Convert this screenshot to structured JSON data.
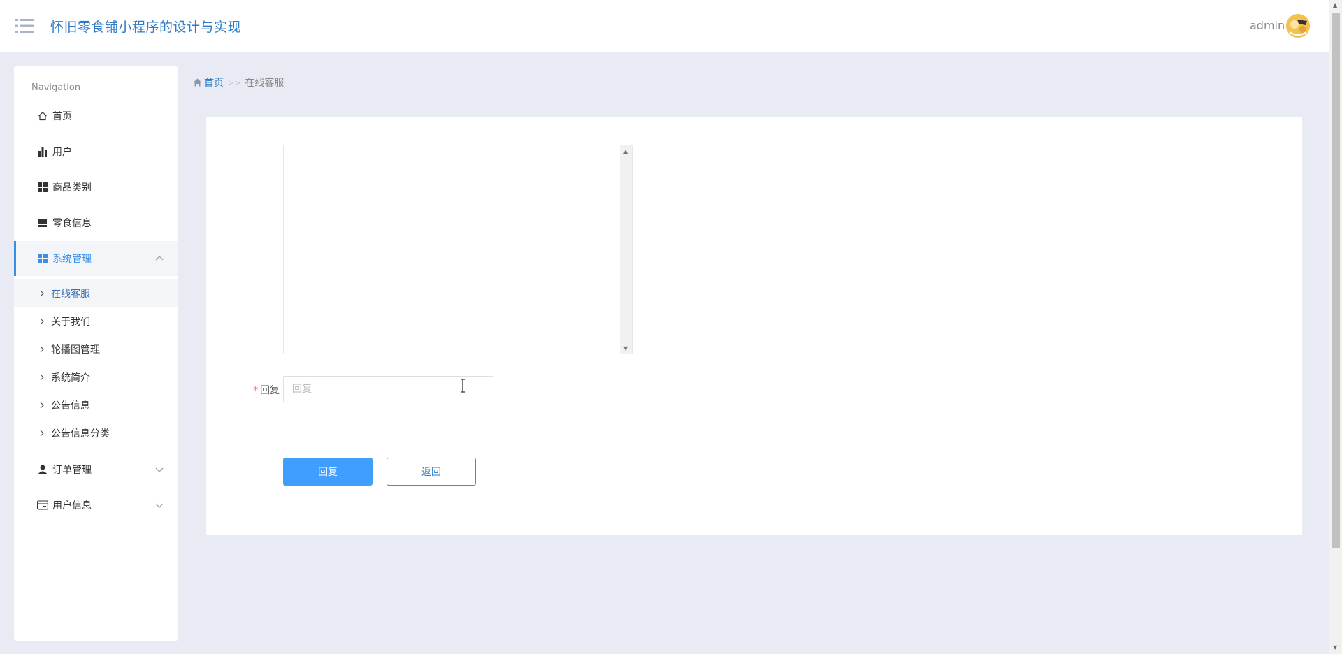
{
  "header": {
    "app_title": "怀旧零食铺小程序的设计与实现",
    "username": "admin"
  },
  "sidebar": {
    "caption": "Navigation",
    "items": [
      {
        "label": "首页",
        "icon": "home-icon"
      },
      {
        "label": "用户",
        "icon": "bar-chart-icon"
      },
      {
        "label": "商品类别",
        "icon": "grid-icon"
      },
      {
        "label": "零食信息",
        "icon": "shop-icon"
      },
      {
        "label": "系统管理",
        "icon": "grid-icon",
        "expanded": true
      },
      {
        "label": "订单管理",
        "icon": "user-icon"
      },
      {
        "label": "用户信息",
        "icon": "card-icon"
      }
    ],
    "sub_items": [
      {
        "label": "在线客服",
        "active": true
      },
      {
        "label": "关于我们"
      },
      {
        "label": "轮播图管理"
      },
      {
        "label": "系统简介"
      },
      {
        "label": "公告信息"
      },
      {
        "label": "公告信息分类"
      }
    ]
  },
  "breadcrumb": {
    "home": "首页",
    "separator": ">>",
    "current": "在线客服"
  },
  "form": {
    "reply_label": "回复",
    "required_mark": "*",
    "reply_placeholder": "回复",
    "reply_value": "",
    "submit_label": "回复",
    "back_label": "返回"
  },
  "colors": {
    "accent": "#409eff",
    "title": "#2f7cc4",
    "background": "#e8ebf3"
  }
}
